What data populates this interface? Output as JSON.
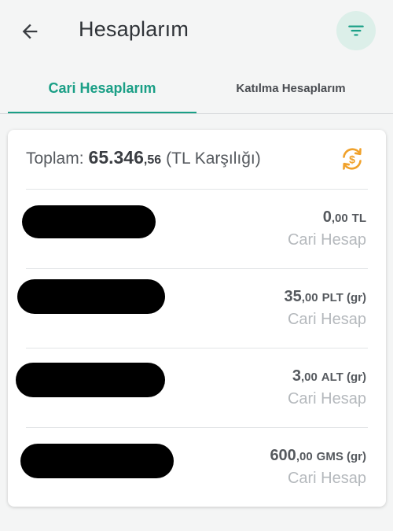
{
  "header": {
    "title": "Hesaplarım",
    "back_icon": "arrow-left-icon",
    "filter_icon": "filter-icon"
  },
  "tabs": [
    {
      "label": "Cari Hesaplarım",
      "active": true
    },
    {
      "label": "Katılma Hesaplarım",
      "active": false
    }
  ],
  "summary": {
    "prefix": "Toplam:",
    "amount_int": "65.346",
    "amount_dec": ",56",
    "suffix": "(TL Karşılığı)",
    "exchange_icon": "currency-exchange-icon"
  },
  "accounts": [
    {
      "name_redacted": true,
      "amount_int": "0",
      "amount_dec": ",00",
      "currency": "TL",
      "type": "Cari Hesap"
    },
    {
      "name_redacted": true,
      "amount_int": "35",
      "amount_dec": ",00",
      "currency": "PLT (gr)",
      "type": "Cari Hesap"
    },
    {
      "name_redacted": true,
      "amount_int": "3",
      "amount_dec": ",00",
      "currency": "ALT (gr)",
      "type": "Cari Hesap"
    },
    {
      "name_redacted": true,
      "amount_int": "600",
      "amount_dec": ",00",
      "currency": "GMS (gr)",
      "type": "Cari Hesap"
    }
  ],
  "colors": {
    "accent": "#1a9f86",
    "filter_bg": "#dcefe9",
    "exchange_icon": "#f0a12a",
    "muted_text": "#b5b9bd"
  }
}
